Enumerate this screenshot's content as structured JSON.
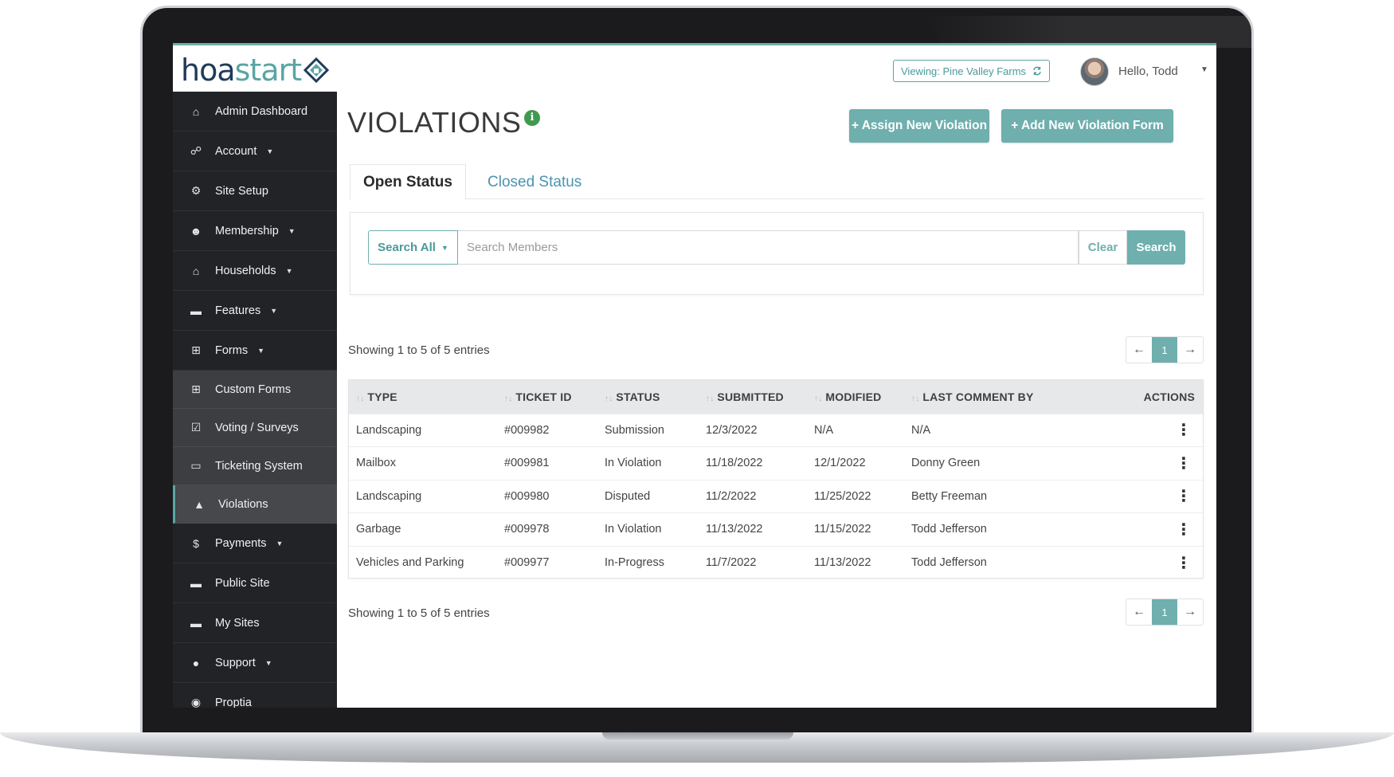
{
  "header": {
    "logo_part1": "hoa",
    "logo_part2": "start",
    "viewing_label": "Viewing: Pine Valley Farms",
    "greeting": "Hello, Todd"
  },
  "sidebar": {
    "items": [
      {
        "label": "Admin Dashboard",
        "icon": "home-icon"
      },
      {
        "label": "Account",
        "icon": "sitemap-icon",
        "has_caret": true
      },
      {
        "label": "Site Setup",
        "icon": "gear-icon"
      },
      {
        "label": "Membership",
        "icon": "users-icon",
        "has_caret": true
      },
      {
        "label": "Households",
        "icon": "home-icon",
        "has_caret": true
      },
      {
        "label": "Features",
        "icon": "window-icon",
        "has_caret": true
      },
      {
        "label": "Forms",
        "icon": "table-icon",
        "has_caret": true
      },
      {
        "label": "Custom Forms",
        "icon": "table-icon",
        "submenu": true
      },
      {
        "label": "Voting / Surveys",
        "icon": "check-square-icon",
        "submenu": true
      },
      {
        "label": "Ticketing System",
        "icon": "ticket-icon",
        "submenu": true
      },
      {
        "label": "Violations",
        "icon": "warning-icon",
        "submenu": true,
        "active": true
      },
      {
        "label": "Payments",
        "icon": "dollar-icon",
        "has_caret": true
      },
      {
        "label": "Public Site",
        "icon": "window-icon"
      },
      {
        "label": "My Sites",
        "icon": "window-icon"
      },
      {
        "label": "Support",
        "icon": "info-icon",
        "has_caret": true
      },
      {
        "label": "Proptia",
        "icon": "proptia-icon"
      }
    ]
  },
  "page": {
    "title": "VIOLATIONS",
    "assign_button": "+ Assign New Violation",
    "add_form_button": "+ Add New Violation Form",
    "tabs": [
      "Open Status",
      "Closed Status"
    ],
    "search": {
      "scope": "Search All",
      "placeholder": "Search Members",
      "value": "",
      "clear_label": "Clear",
      "search_label": "Search"
    },
    "showing_top": "Showing 1 to 5 of 5 entries",
    "showing_bottom": "Showing 1 to 5 of 5 entries",
    "current_page": "1"
  },
  "table": {
    "columns": [
      "TYPE",
      "TICKET ID",
      "STATUS",
      "SUBMITTED",
      "MODIFIED",
      "LAST COMMENT BY",
      "ACTIONS"
    ],
    "rows": [
      [
        "Landscaping",
        "#009982",
        "Submission",
        "12/3/2022",
        "N/A",
        "N/A"
      ],
      [
        "Mailbox",
        "#009981",
        "In Violation",
        "11/18/2022",
        "12/1/2022",
        "Donny Green"
      ],
      [
        "Landscaping",
        "#009980",
        "Disputed",
        "11/2/2022",
        "11/25/2022",
        "Betty Freeman"
      ],
      [
        "Garbage",
        "#009978",
        "In Violation",
        "11/13/2022",
        "11/15/2022",
        "Todd Jefferson"
      ],
      [
        "Vehicles and Parking",
        "#009977",
        "In-Progress",
        "11/7/2022",
        "11/13/2022",
        "Todd Jefferson"
      ]
    ]
  },
  "colors": {
    "accent": "#6fafae",
    "sidebar_bg": "#212326",
    "info_badge": "#3f9a4f"
  }
}
